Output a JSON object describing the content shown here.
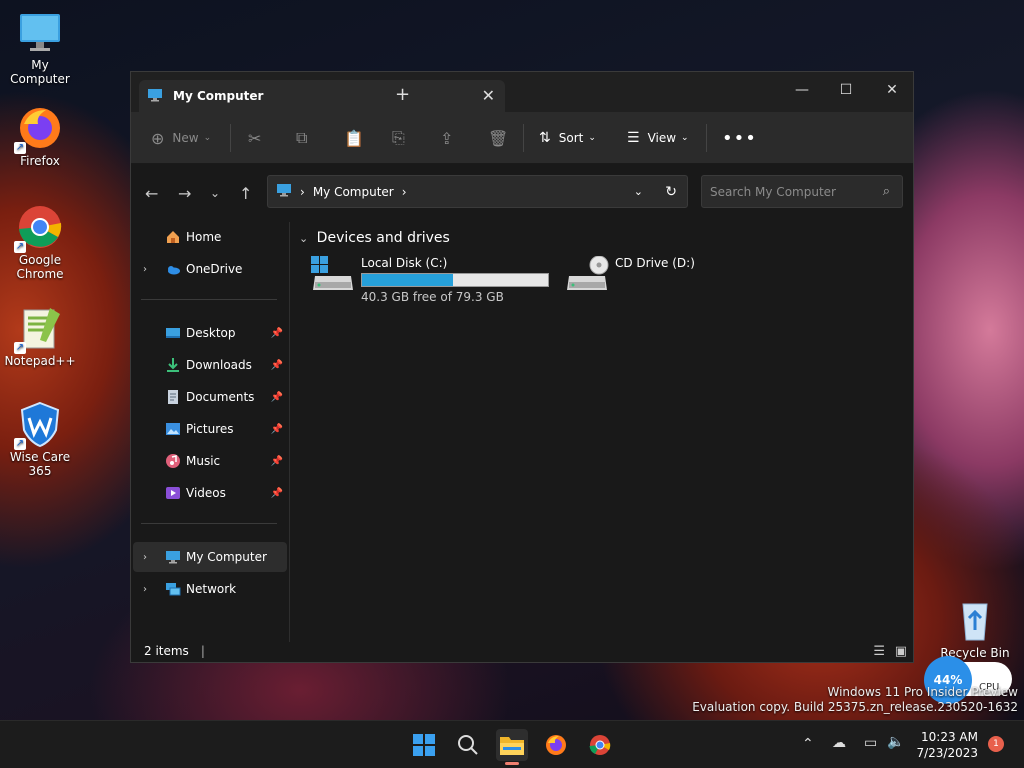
{
  "desktop": {
    "icons": [
      {
        "label": "My Computer"
      },
      {
        "label": "Firefox"
      },
      {
        "label": "Google Chrome"
      },
      {
        "label": "Notepad++"
      },
      {
        "label": "Wise Care 365"
      },
      {
        "label": "Recycle Bin"
      }
    ]
  },
  "window": {
    "tab_title": "My Computer",
    "toolbar": {
      "new_label": "New",
      "sort_label": "Sort",
      "view_label": "View"
    },
    "address": {
      "crumb": "My Computer"
    },
    "search": {
      "placeholder": "Search My Computer"
    },
    "sidebar": {
      "items": [
        {
          "label": "Home"
        },
        {
          "label": "OneDrive"
        },
        {
          "label": "Desktop"
        },
        {
          "label": "Downloads"
        },
        {
          "label": "Documents"
        },
        {
          "label": "Pictures"
        },
        {
          "label": "Music"
        },
        {
          "label": "Videos"
        },
        {
          "label": "My Computer"
        },
        {
          "label": "Network"
        }
      ]
    },
    "content": {
      "group_title": "Devices and drives",
      "drives": [
        {
          "name": "Local Disk (C:)",
          "free_text": "40.3 GB free of 79.3 GB",
          "used_fraction": 0.49
        },
        {
          "name": "CD Drive (D:)"
        }
      ]
    },
    "status": {
      "items_count": "2 items"
    }
  },
  "widget": {
    "cpu_percent": "44%",
    "cpu_label": "CPU"
  },
  "watermark": {
    "line1": "Windows 11 Pro Insider Preview",
    "line2": "Evaluation copy. Build 25375.zn_release.230520-1632"
  },
  "taskbar": {
    "time": "10:23 AM",
    "date": "7/23/2023",
    "notification_count": "1"
  },
  "colors": {
    "accent": "#26a0da",
    "window_bg": "#191919",
    "toolbar_bg": "#2b2b2b"
  }
}
